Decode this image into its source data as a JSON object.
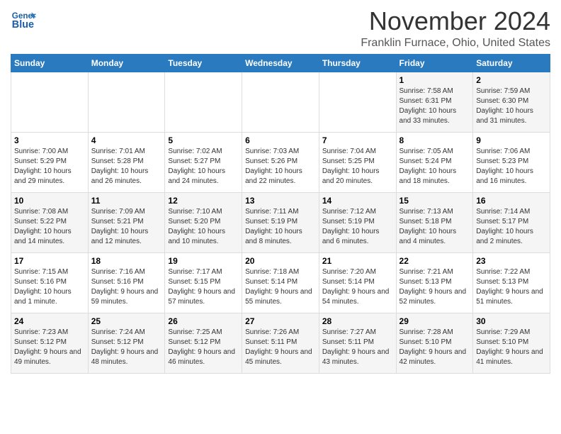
{
  "logo": {
    "line1": "General",
    "line2": "Blue"
  },
  "title": "November 2024",
  "location": "Franklin Furnace, Ohio, United States",
  "days_of_week": [
    "Sunday",
    "Monday",
    "Tuesday",
    "Wednesday",
    "Thursday",
    "Friday",
    "Saturday"
  ],
  "weeks": [
    [
      {
        "day": "",
        "info": ""
      },
      {
        "day": "",
        "info": ""
      },
      {
        "day": "",
        "info": ""
      },
      {
        "day": "",
        "info": ""
      },
      {
        "day": "",
        "info": ""
      },
      {
        "day": "1",
        "info": "Sunrise: 7:58 AM\nSunset: 6:31 PM\nDaylight: 10 hours and 33 minutes."
      },
      {
        "day": "2",
        "info": "Sunrise: 7:59 AM\nSunset: 6:30 PM\nDaylight: 10 hours and 31 minutes."
      }
    ],
    [
      {
        "day": "3",
        "info": "Sunrise: 7:00 AM\nSunset: 5:29 PM\nDaylight: 10 hours and 29 minutes."
      },
      {
        "day": "4",
        "info": "Sunrise: 7:01 AM\nSunset: 5:28 PM\nDaylight: 10 hours and 26 minutes."
      },
      {
        "day": "5",
        "info": "Sunrise: 7:02 AM\nSunset: 5:27 PM\nDaylight: 10 hours and 24 minutes."
      },
      {
        "day": "6",
        "info": "Sunrise: 7:03 AM\nSunset: 5:26 PM\nDaylight: 10 hours and 22 minutes."
      },
      {
        "day": "7",
        "info": "Sunrise: 7:04 AM\nSunset: 5:25 PM\nDaylight: 10 hours and 20 minutes."
      },
      {
        "day": "8",
        "info": "Sunrise: 7:05 AM\nSunset: 5:24 PM\nDaylight: 10 hours and 18 minutes."
      },
      {
        "day": "9",
        "info": "Sunrise: 7:06 AM\nSunset: 5:23 PM\nDaylight: 10 hours and 16 minutes."
      }
    ],
    [
      {
        "day": "10",
        "info": "Sunrise: 7:08 AM\nSunset: 5:22 PM\nDaylight: 10 hours and 14 minutes."
      },
      {
        "day": "11",
        "info": "Sunrise: 7:09 AM\nSunset: 5:21 PM\nDaylight: 10 hours and 12 minutes."
      },
      {
        "day": "12",
        "info": "Sunrise: 7:10 AM\nSunset: 5:20 PM\nDaylight: 10 hours and 10 minutes."
      },
      {
        "day": "13",
        "info": "Sunrise: 7:11 AM\nSunset: 5:19 PM\nDaylight: 10 hours and 8 minutes."
      },
      {
        "day": "14",
        "info": "Sunrise: 7:12 AM\nSunset: 5:19 PM\nDaylight: 10 hours and 6 minutes."
      },
      {
        "day": "15",
        "info": "Sunrise: 7:13 AM\nSunset: 5:18 PM\nDaylight: 10 hours and 4 minutes."
      },
      {
        "day": "16",
        "info": "Sunrise: 7:14 AM\nSunset: 5:17 PM\nDaylight: 10 hours and 2 minutes."
      }
    ],
    [
      {
        "day": "17",
        "info": "Sunrise: 7:15 AM\nSunset: 5:16 PM\nDaylight: 10 hours and 1 minute."
      },
      {
        "day": "18",
        "info": "Sunrise: 7:16 AM\nSunset: 5:16 PM\nDaylight: 9 hours and 59 minutes."
      },
      {
        "day": "19",
        "info": "Sunrise: 7:17 AM\nSunset: 5:15 PM\nDaylight: 9 hours and 57 minutes."
      },
      {
        "day": "20",
        "info": "Sunrise: 7:18 AM\nSunset: 5:14 PM\nDaylight: 9 hours and 55 minutes."
      },
      {
        "day": "21",
        "info": "Sunrise: 7:20 AM\nSunset: 5:14 PM\nDaylight: 9 hours and 54 minutes."
      },
      {
        "day": "22",
        "info": "Sunrise: 7:21 AM\nSunset: 5:13 PM\nDaylight: 9 hours and 52 minutes."
      },
      {
        "day": "23",
        "info": "Sunrise: 7:22 AM\nSunset: 5:13 PM\nDaylight: 9 hours and 51 minutes."
      }
    ],
    [
      {
        "day": "24",
        "info": "Sunrise: 7:23 AM\nSunset: 5:12 PM\nDaylight: 9 hours and 49 minutes."
      },
      {
        "day": "25",
        "info": "Sunrise: 7:24 AM\nSunset: 5:12 PM\nDaylight: 9 hours and 48 minutes."
      },
      {
        "day": "26",
        "info": "Sunrise: 7:25 AM\nSunset: 5:12 PM\nDaylight: 9 hours and 46 minutes."
      },
      {
        "day": "27",
        "info": "Sunrise: 7:26 AM\nSunset: 5:11 PM\nDaylight: 9 hours and 45 minutes."
      },
      {
        "day": "28",
        "info": "Sunrise: 7:27 AM\nSunset: 5:11 PM\nDaylight: 9 hours and 43 minutes."
      },
      {
        "day": "29",
        "info": "Sunrise: 7:28 AM\nSunset: 5:10 PM\nDaylight: 9 hours and 42 minutes."
      },
      {
        "day": "30",
        "info": "Sunrise: 7:29 AM\nSunset: 5:10 PM\nDaylight: 9 hours and 41 minutes."
      }
    ]
  ]
}
